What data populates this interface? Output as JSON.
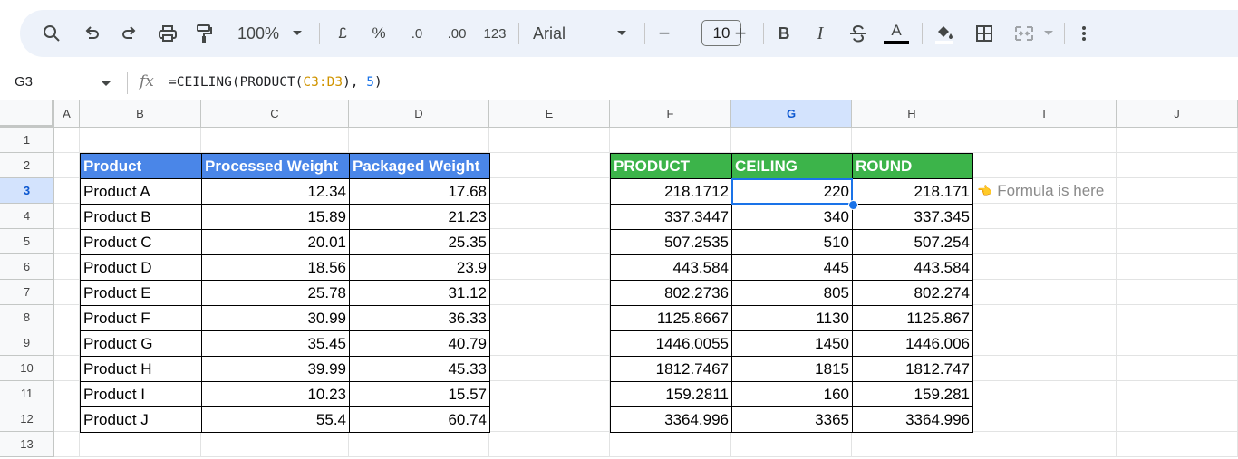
{
  "toolbar": {
    "zoom": "100%",
    "currency": "£",
    "percent": "%",
    "dec_decrease": ".0",
    "dec_increase": ".00",
    "format_more": "123",
    "font": "Arial",
    "font_size": "10",
    "minus": "−",
    "plus": "+",
    "bold": "B",
    "italic": "I",
    "text_color": "A"
  },
  "formula_bar": {
    "name_box": "G3",
    "formula_prefix": "=CEILING(PRODUCT(",
    "formula_ref": "C3:D3",
    "formula_mid": "), ",
    "formula_num": "5",
    "formula_suffix": ")"
  },
  "columns": [
    "A",
    "B",
    "C",
    "D",
    "E",
    "F",
    "G",
    "H",
    "I",
    "J"
  ],
  "rows": [
    "1",
    "2",
    "3",
    "4",
    "5",
    "6",
    "7",
    "8",
    "9",
    "10",
    "11",
    "12",
    "13"
  ],
  "left_table": {
    "headers": [
      "Product",
      "Processed Weight",
      "Packaged Weight"
    ],
    "rows": [
      [
        "Product A",
        "12.34",
        "17.68"
      ],
      [
        "Product B",
        "15.89",
        "21.23"
      ],
      [
        "Product C",
        "20.01",
        "25.35"
      ],
      [
        "Product D",
        "18.56",
        "23.9"
      ],
      [
        "Product E",
        "25.78",
        "31.12"
      ],
      [
        "Product F",
        "30.99",
        "36.33"
      ],
      [
        "Product G",
        "35.45",
        "40.79"
      ],
      [
        "Product H",
        "39.99",
        "45.33"
      ],
      [
        "Product I",
        "10.23",
        "15.57"
      ],
      [
        "Product J",
        "55.4",
        "60.74"
      ]
    ]
  },
  "right_table": {
    "headers": [
      "PRODUCT",
      "CEILING",
      "ROUND"
    ],
    "rows": [
      [
        "218.1712",
        "220",
        "218.171"
      ],
      [
        "337.3447",
        "340",
        "337.345"
      ],
      [
        "507.2535",
        "510",
        "507.254"
      ],
      [
        "443.584",
        "445",
        "443.584"
      ],
      [
        "802.2736",
        "805",
        "802.274"
      ],
      [
        "1125.8667",
        "1130",
        "1125.867"
      ],
      [
        "1446.0055",
        "1450",
        "1446.006"
      ],
      [
        "1812.7467",
        "1815",
        "1812.747"
      ],
      [
        "159.2811",
        "160",
        "159.281"
      ],
      [
        "3364.996",
        "3365",
        "3364.996"
      ]
    ]
  },
  "annotation": {
    "emoji": "👈",
    "text": "Formula is here"
  },
  "colors": {
    "blue_header": "#4a86e8",
    "green_header": "#3cb44a",
    "selection": "#1a73e8"
  }
}
